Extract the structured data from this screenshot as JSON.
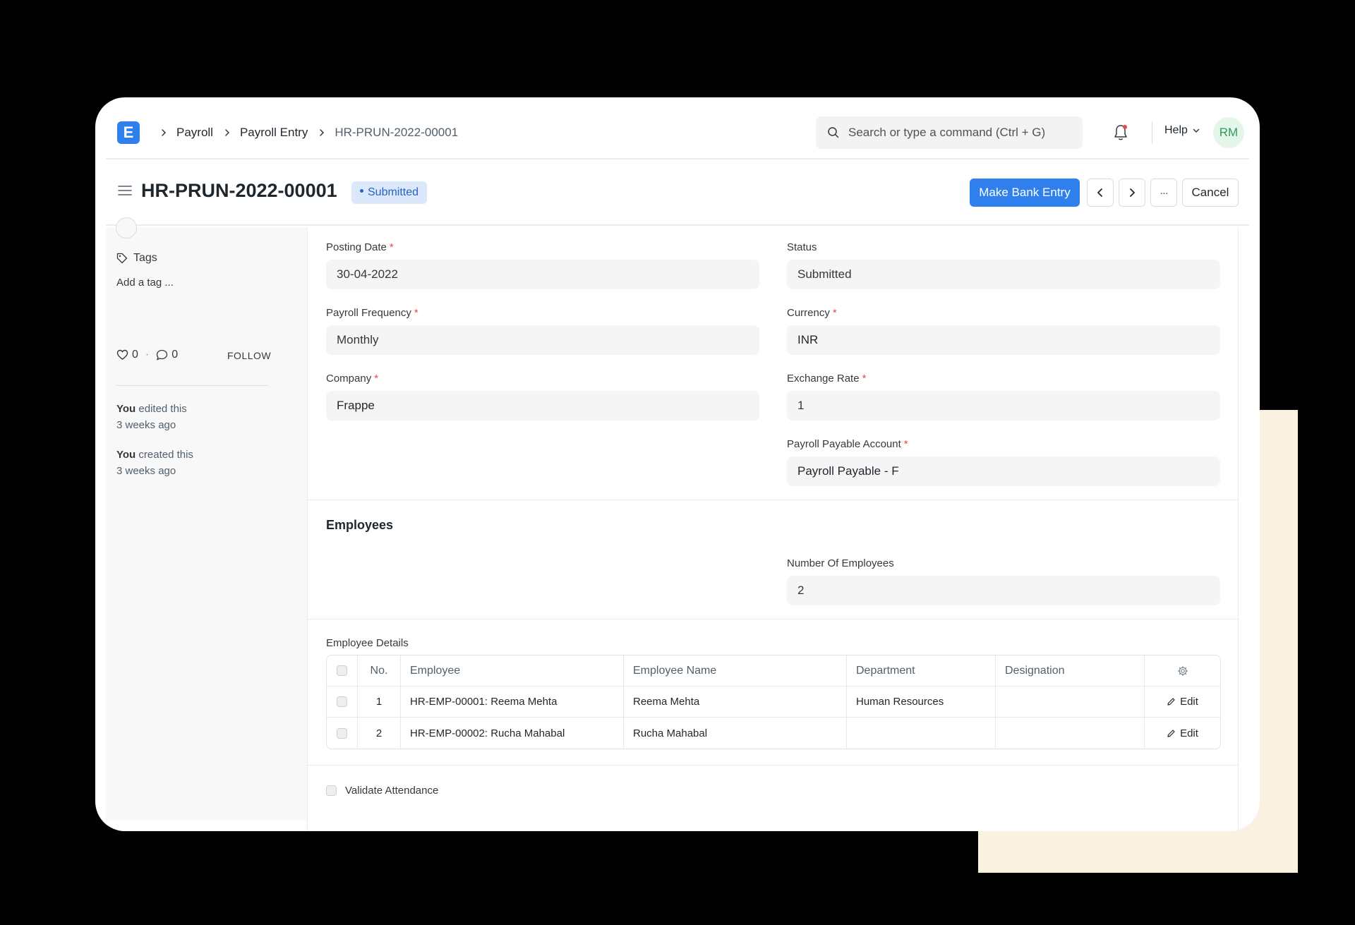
{
  "navbar": {
    "logo_letter": "E",
    "breadcrumbs": [
      "Payroll",
      "Payroll Entry",
      "HR-PRUN-2022-00001"
    ],
    "search_placeholder": "Search or type a command (Ctrl + G)",
    "help_label": "Help",
    "avatar_initials": "RM"
  },
  "page_head": {
    "title": "HR-PRUN-2022-00001",
    "status": "Submitted",
    "primary_action": "Make Bank Entry",
    "more_label": "···",
    "cancel_label": "Cancel"
  },
  "sidebar": {
    "tags_label": "Tags",
    "add_tag": "Add a tag ...",
    "likes": "0",
    "comments": "0",
    "follow": "FOLLOW",
    "activity": [
      {
        "who": "You",
        "action": " edited this",
        "when": "3 weeks ago"
      },
      {
        "who": "You",
        "action": " created this",
        "when": "3 weeks ago"
      }
    ]
  },
  "form": {
    "posting_date": {
      "label": "Posting Date",
      "value": "30-04-2022"
    },
    "status": {
      "label": "Status",
      "value": "Submitted"
    },
    "payroll_frequency": {
      "label": "Payroll Frequency",
      "value": "Monthly"
    },
    "currency": {
      "label": "Currency",
      "value": "INR"
    },
    "company": {
      "label": "Company",
      "value": "Frappe"
    },
    "exchange_rate": {
      "label": "Exchange Rate",
      "value": "1"
    },
    "payroll_payable_account": {
      "label": "Payroll Payable Account",
      "value": "Payroll Payable - F"
    },
    "employees_section": "Employees",
    "number_of_employees": {
      "label": "Number Of Employees",
      "value": "2"
    },
    "employee_details_label": "Employee Details",
    "table": {
      "headers": [
        "No.",
        "Employee",
        "Employee Name",
        "Department",
        "Designation"
      ],
      "rows": [
        {
          "no": "1",
          "employee": "HR-EMP-00001: Reema Mehta",
          "name": "Reema Mehta",
          "department": "Human Resources",
          "designation": "",
          "action": "Edit"
        },
        {
          "no": "2",
          "employee": "HR-EMP-00002: Rucha Mahabal",
          "name": "Rucha Mahabal",
          "department": "",
          "designation": "",
          "action": "Edit"
        }
      ]
    },
    "validate_attendance": "Validate Attendance"
  },
  "colors": {
    "primary": "#2f80ed",
    "status_pill_bg": "#dbe8fb",
    "status_pill_text": "#2563c4",
    "required": "#e24c4c",
    "cream": "#fbf1e1"
  }
}
